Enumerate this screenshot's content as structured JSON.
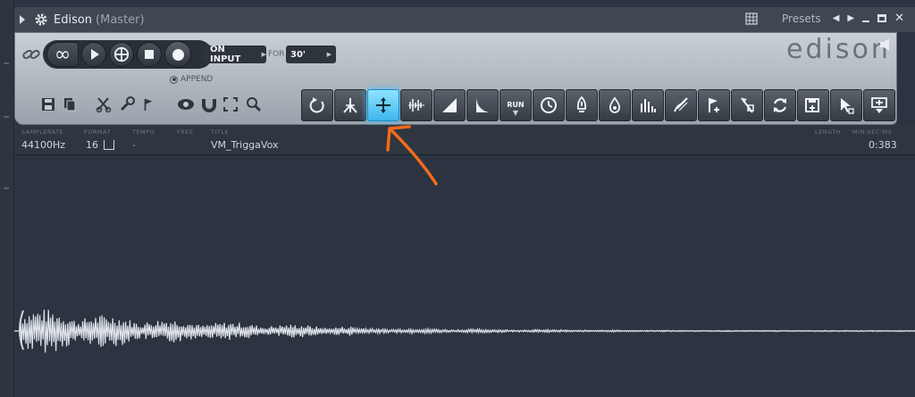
{
  "window": {
    "title": "Edison",
    "subtitle": "(Master)",
    "presets_label": "Presets"
  },
  "transport": {
    "on_input_label": "ON INPUT",
    "for_label": "FOR",
    "duration_value": "30'",
    "append_label": "APPEND"
  },
  "brand": {
    "logo_text": "edison"
  },
  "toolbar": {
    "run_label": "RUN",
    "active_tool": "declick-tool"
  },
  "info": {
    "headers": {
      "samplerate": "SAMPLERATE",
      "format": "FORMAT",
      "tempo": "TEMPO",
      "free": "FREE",
      "title": "TITLE",
      "length": "LENGTH",
      "unit": "MIN:SEC:MS"
    },
    "samplerate": "44100Hz",
    "format": "16",
    "tempo": "-",
    "title": "VM_TriggaVox",
    "length": "0:383"
  },
  "colors": {
    "accent": "#4cc4ff",
    "annotation_arrow": "#f26a1b",
    "waveform": "#dfe3ea"
  }
}
